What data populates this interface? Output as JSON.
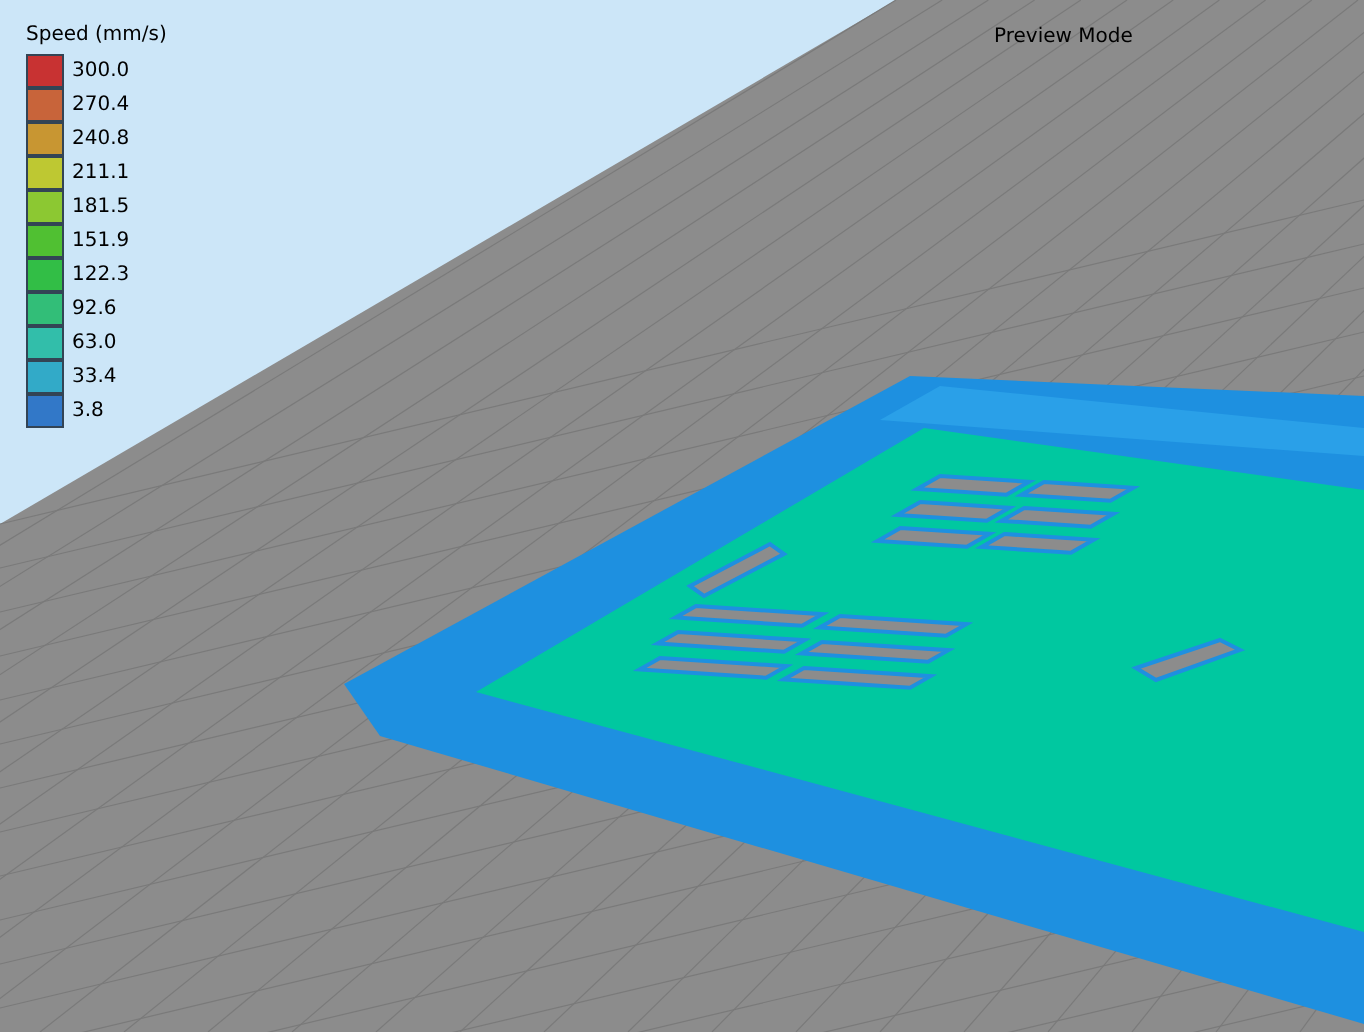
{
  "legend": {
    "title": "Speed (mm/s)",
    "items": [
      {
        "label": "300.0",
        "color": "#c83232"
      },
      {
        "label": "270.4",
        "color": "#c8643a"
      },
      {
        "label": "240.8",
        "color": "#c89632"
      },
      {
        "label": "211.1",
        "color": "#bec832"
      },
      {
        "label": "181.5",
        "color": "#8cc832"
      },
      {
        "label": "151.9",
        "color": "#50c032"
      },
      {
        "label": "122.3",
        "color": "#32be46"
      },
      {
        "label": "92.6",
        "color": "#32be78"
      },
      {
        "label": "63.0",
        "color": "#32beaa"
      },
      {
        "label": "33.4",
        "color": "#32aac8"
      },
      {
        "label": "3.8",
        "color": "#3278c8"
      }
    ]
  },
  "mode_label": "Preview Mode"
}
